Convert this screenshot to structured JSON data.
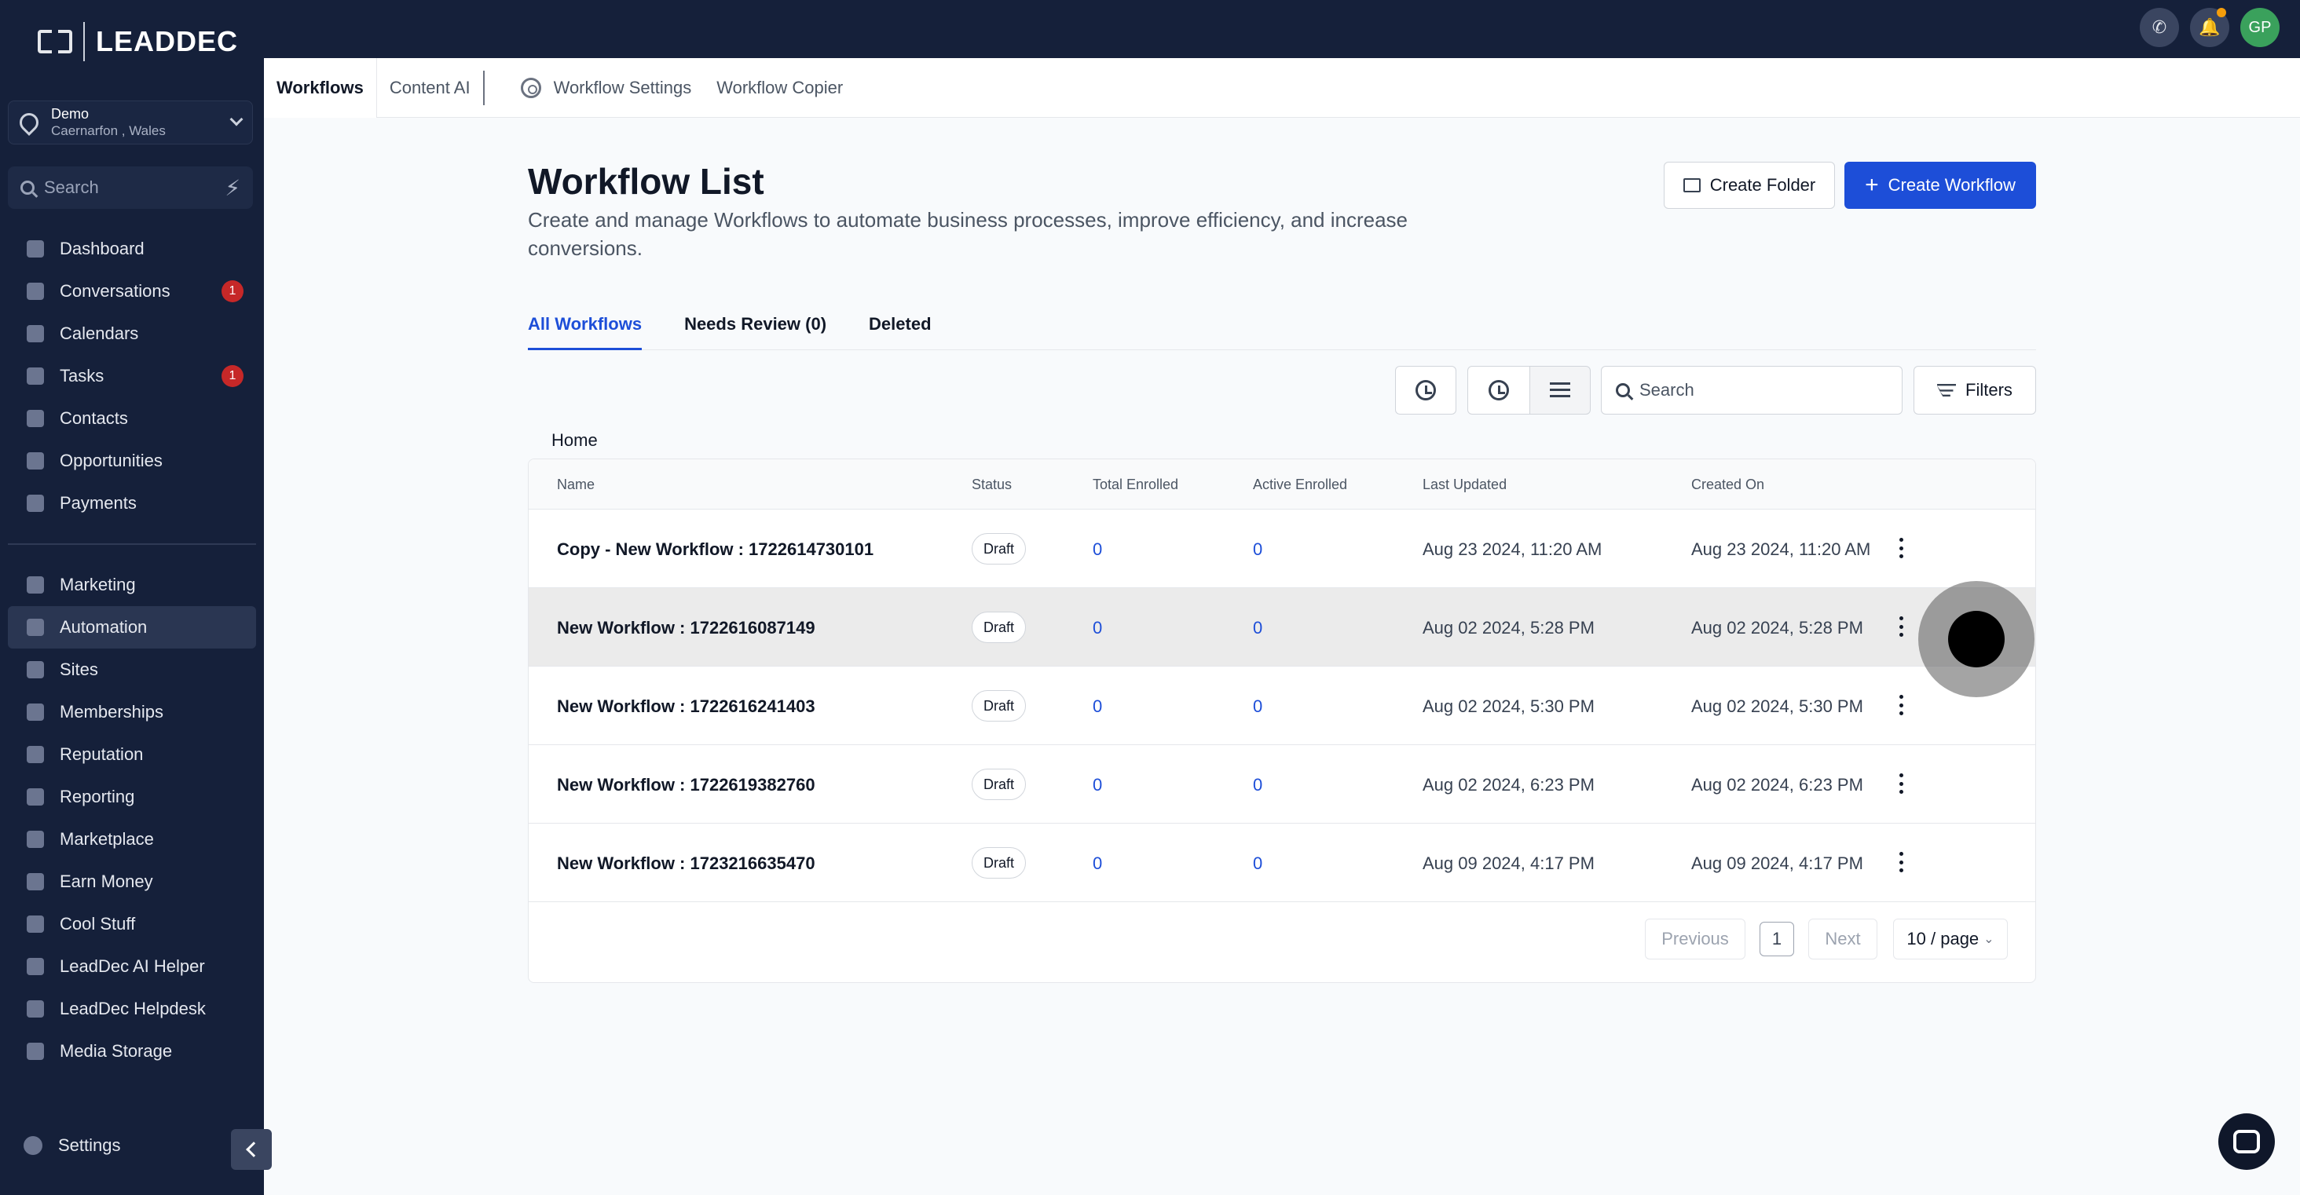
{
  "brand": {
    "name": "LEADDEC"
  },
  "location": {
    "name": "Demo",
    "sub": "Caernarfon , Wales"
  },
  "sidebar": {
    "search_placeholder": "Search",
    "items": [
      {
        "label": "Dashboard",
        "icon": "dashboard-icon"
      },
      {
        "label": "Conversations",
        "icon": "chat-icon",
        "badge": "1"
      },
      {
        "label": "Calendars",
        "icon": "calendar-icon"
      },
      {
        "label": "Tasks",
        "icon": "check-icon",
        "badge": "1"
      },
      {
        "label": "Contacts",
        "icon": "user-icon"
      },
      {
        "label": "Opportunities",
        "icon": "filter-icon"
      },
      {
        "label": "Payments",
        "icon": "card-icon"
      }
    ],
    "items2": [
      {
        "label": "Marketing",
        "icon": "megaphone-icon"
      },
      {
        "label": "Automation",
        "icon": "automation-icon",
        "active": true
      },
      {
        "label": "Sites",
        "icon": "globe-icon"
      },
      {
        "label": "Memberships",
        "icon": "members-icon"
      },
      {
        "label": "Reputation",
        "icon": "star-icon"
      },
      {
        "label": "Reporting",
        "icon": "chart-icon"
      },
      {
        "label": "Marketplace",
        "icon": "cart-icon"
      },
      {
        "label": "Earn Money",
        "icon": "money-icon"
      },
      {
        "label": "Cool Stuff",
        "icon": "fire-icon"
      },
      {
        "label": "LeadDec AI Helper",
        "icon": "robot-icon"
      },
      {
        "label": "LeadDec Helpdesk",
        "icon": "info-icon"
      },
      {
        "label": "Media Storage",
        "icon": "image-icon"
      }
    ],
    "settings_label": "Settings"
  },
  "topbar": {
    "avatar_initials": "GP"
  },
  "subnav": {
    "workflows": "Workflows",
    "content_ai": "Content AI",
    "settings": "Workflow Settings",
    "copier": "Workflow Copier"
  },
  "header": {
    "title": "Workflow List",
    "description": "Create and manage Workflows to automate business processes, improve efficiency, and increase conversions.",
    "create_folder": "Create Folder",
    "create_workflow": "Create Workflow"
  },
  "tabs": {
    "all": "All Workflows",
    "review": "Needs Review (0)",
    "deleted": "Deleted"
  },
  "toolbar": {
    "search_placeholder": "Search",
    "filters": "Filters"
  },
  "breadcrumb": "Home",
  "table": {
    "columns": {
      "name": "Name",
      "status": "Status",
      "total": "Total Enrolled",
      "active": "Active Enrolled",
      "updated": "Last Updated",
      "created": "Created On"
    },
    "rows": [
      {
        "name": "Copy - New Workflow : 1722614730101",
        "status": "Draft",
        "total": "0",
        "active": "0",
        "updated": "Aug 23 2024, 11:20 AM",
        "created": "Aug 23 2024, 11:20 AM"
      },
      {
        "name": "New Workflow : 1722616087149",
        "status": "Draft",
        "total": "0",
        "active": "0",
        "updated": "Aug 02 2024, 5:28 PM",
        "created": "Aug 02 2024, 5:28 PM"
      },
      {
        "name": "New Workflow : 1722616241403",
        "status": "Draft",
        "total": "0",
        "active": "0",
        "updated": "Aug 02 2024, 5:30 PM",
        "created": "Aug 02 2024, 5:30 PM"
      },
      {
        "name": "New Workflow : 1722619382760",
        "status": "Draft",
        "total": "0",
        "active": "0",
        "updated": "Aug 02 2024, 6:23 PM",
        "created": "Aug 02 2024, 6:23 PM"
      },
      {
        "name": "New Workflow : 1723216635470",
        "status": "Draft",
        "total": "0",
        "active": "0",
        "updated": "Aug 09 2024, 4:17 PM",
        "created": "Aug 09 2024, 4:17 PM"
      }
    ]
  },
  "pagination": {
    "previous": "Previous",
    "page": "1",
    "next": "Next",
    "page_size": "10 / page"
  }
}
